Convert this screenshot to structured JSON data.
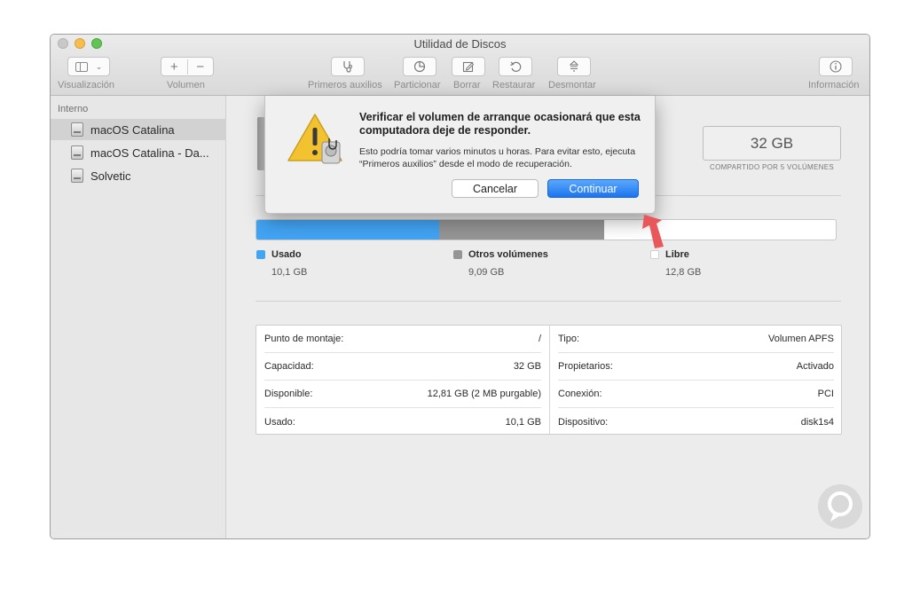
{
  "window": {
    "title": "Utilidad de Discos"
  },
  "toolbar": {
    "view": {
      "label": "Visualización"
    },
    "volume": {
      "label": "Volumen",
      "add": "+",
      "remove": "−"
    },
    "first_aid": {
      "label": "Primeros auxilios"
    },
    "partition": {
      "label": "Particionar"
    },
    "erase": {
      "label": "Borrar"
    },
    "restore": {
      "label": "Restaurar"
    },
    "unmount": {
      "label": "Desmontar"
    },
    "info": {
      "label": "Información"
    }
  },
  "sidebar": {
    "section": "Interno",
    "items": [
      {
        "label": "macOS Catalina",
        "selected": true
      },
      {
        "label": "macOS Catalina - Da..."
      },
      {
        "label": "Solvetic"
      }
    ]
  },
  "volume": {
    "capacity": "32 GB",
    "shared_note": "COMPARTIDO POR 5 VOLÚMENES"
  },
  "usage": {
    "segments": [
      {
        "name": "Usado",
        "value": "10,1 GB",
        "gb": 10.1,
        "color": "#42a4f4"
      },
      {
        "name": "Otros volúmenes",
        "value": "9,09 GB",
        "gb": 9.09,
        "color": "#959595"
      },
      {
        "name": "Libre",
        "value": "12,8 GB",
        "gb": 12.8,
        "color": "#ffffff"
      }
    ]
  },
  "info": {
    "left": [
      {
        "key": "Punto de montaje:",
        "value": "/"
      },
      {
        "key": "Capacidad:",
        "value": "32 GB"
      },
      {
        "key": "Disponible:",
        "value": "12,81 GB (2 MB purgable)"
      },
      {
        "key": "Usado:",
        "value": "10,1 GB"
      }
    ],
    "right": [
      {
        "key": "Tipo:",
        "value": "Volumen APFS"
      },
      {
        "key": "Propietarios:",
        "value": "Activado"
      },
      {
        "key": "Conexión:",
        "value": "PCI"
      },
      {
        "key": "Dispositivo:",
        "value": "disk1s4"
      }
    ]
  },
  "dialog": {
    "title": "Verificar el volumen de arranque ocasionará que esta computadora deje de responder.",
    "body": "Esto podría tomar varios minutos u horas. Para evitar esto, ejecuta “Primeros auxilios” desde el modo de recuperación.",
    "cancel": "Cancelar",
    "continue": "Continuar"
  },
  "colors": {
    "accent": "#1c74ef",
    "used": "#42a4f4",
    "other": "#959595",
    "arrow": "#e8585a"
  }
}
